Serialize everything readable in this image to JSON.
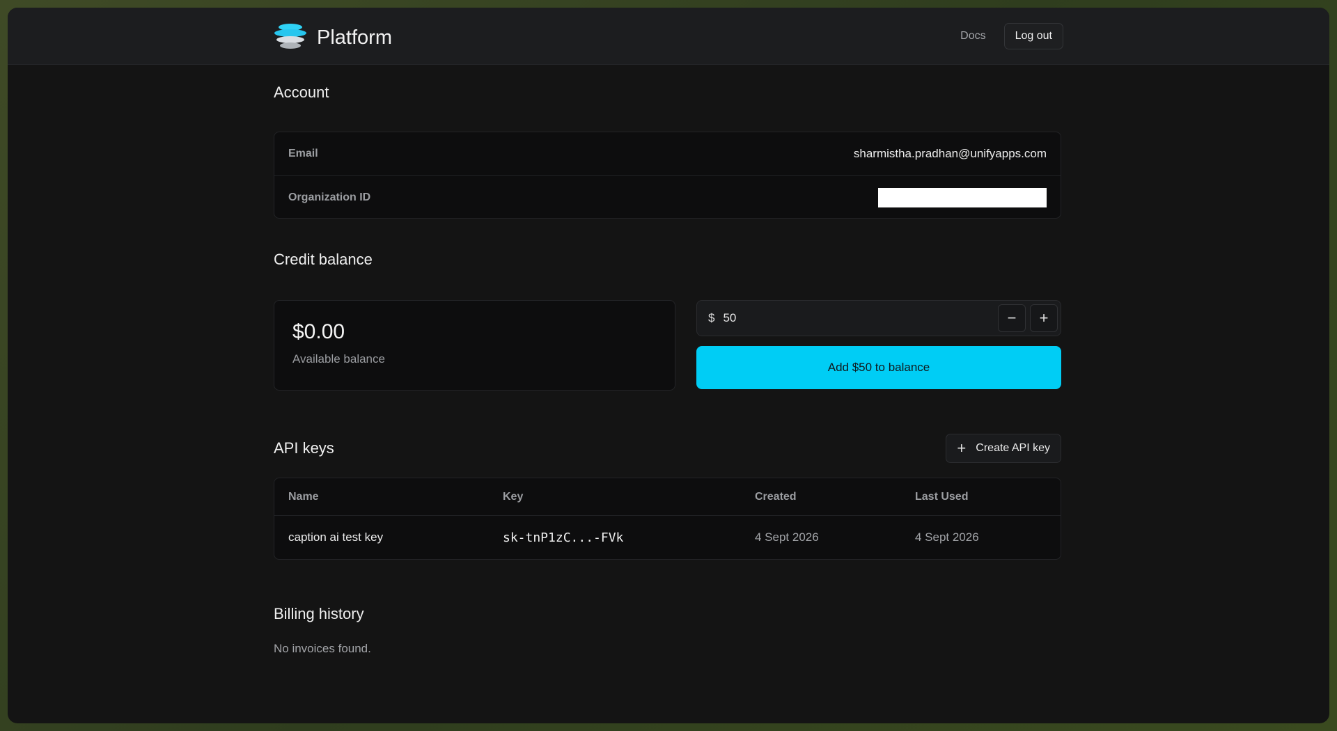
{
  "app": {
    "name": "Platform"
  },
  "nav": {
    "docs": "Docs",
    "logout": "Log out"
  },
  "account": {
    "title": "Account",
    "email_label": "Email",
    "email_value": "sharmistha.pradhan@unifyapps.com",
    "org_label": "Organization ID"
  },
  "credit": {
    "title": "Credit balance",
    "balance": "$0.00",
    "balance_label": "Available balance",
    "currency_symbol": "$",
    "amount": "50",
    "add_label": "Add $50 to balance"
  },
  "api_keys": {
    "title": "API keys",
    "create_label": "Create API key",
    "columns": [
      "Name",
      "Key",
      "Created",
      "Last Used"
    ],
    "rows": [
      {
        "name": "caption ai test key",
        "key": "sk-tnP1zC...-FVk",
        "created": "4 Sept 2026",
        "last_used": "4 Sept 2026"
      }
    ]
  },
  "billing": {
    "title": "Billing history",
    "empty": "No invoices found."
  },
  "colors": {
    "accent": "#00cdf5",
    "background": "#141414",
    "card": "#0d0d0e"
  }
}
